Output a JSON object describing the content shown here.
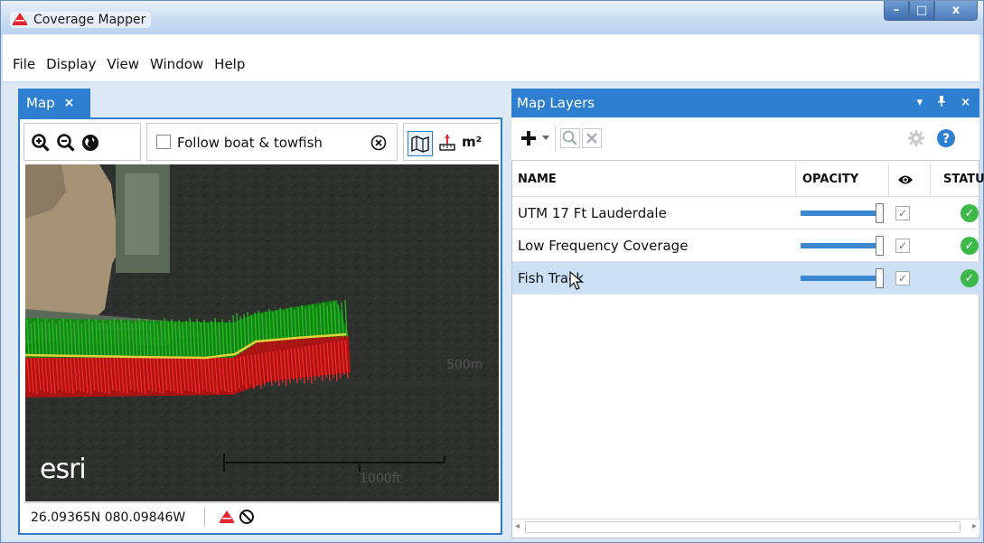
{
  "window": {
    "title": "Coverage Mapper",
    "controls": {
      "minimize": "–",
      "maximize": "□",
      "close": "x"
    }
  },
  "menu": {
    "items": [
      "File",
      "Display",
      "View",
      "Window",
      "Help"
    ]
  },
  "map_panel": {
    "tab_label": "Map",
    "tab_close": "×",
    "toolbar": {
      "follow_label": "Follow boat & towfish",
      "area_unit_label": "m²"
    },
    "map": {
      "attribution": "esri",
      "scale_metric": "500m",
      "scale_imperial": "1000ft"
    },
    "status": {
      "coordinates": "26.09365N 080.09846W"
    }
  },
  "layers_panel": {
    "title": "Map Layers",
    "header_controls": {
      "menu": "▾",
      "pin": "ᵖ",
      "close": "×"
    },
    "columns": {
      "name": "NAME",
      "opacity": "OPACITY",
      "status": "STATU"
    },
    "rows": [
      {
        "name": "UTM 17 Ft Lauderdale",
        "opacity": 1.0,
        "visible": true,
        "status": "ok",
        "selected": false
      },
      {
        "name": "Low Frequency Coverage",
        "opacity": 1.0,
        "visible": true,
        "status": "ok",
        "selected": false
      },
      {
        "name": "Fish Track",
        "opacity": 1.0,
        "visible": true,
        "status": "ok",
        "selected": true
      }
    ]
  },
  "colors": {
    "accent": "#2e7fd0",
    "status_ok": "#3fb84a",
    "track_green": "#1aa51a",
    "track_red": "#e01a1a",
    "track_line": "#e3d23a"
  },
  "icons": [
    "app-icon",
    "zoom-in-icon",
    "zoom-out-icon",
    "globe-icon",
    "clear-icon",
    "map-icon",
    "measure-icon",
    "boat-icon",
    "stop-icon",
    "add-icon",
    "dropdown-icon",
    "search-icon",
    "remove-icon",
    "settings-icon",
    "help-icon",
    "eye-icon",
    "check-status-icon"
  ]
}
